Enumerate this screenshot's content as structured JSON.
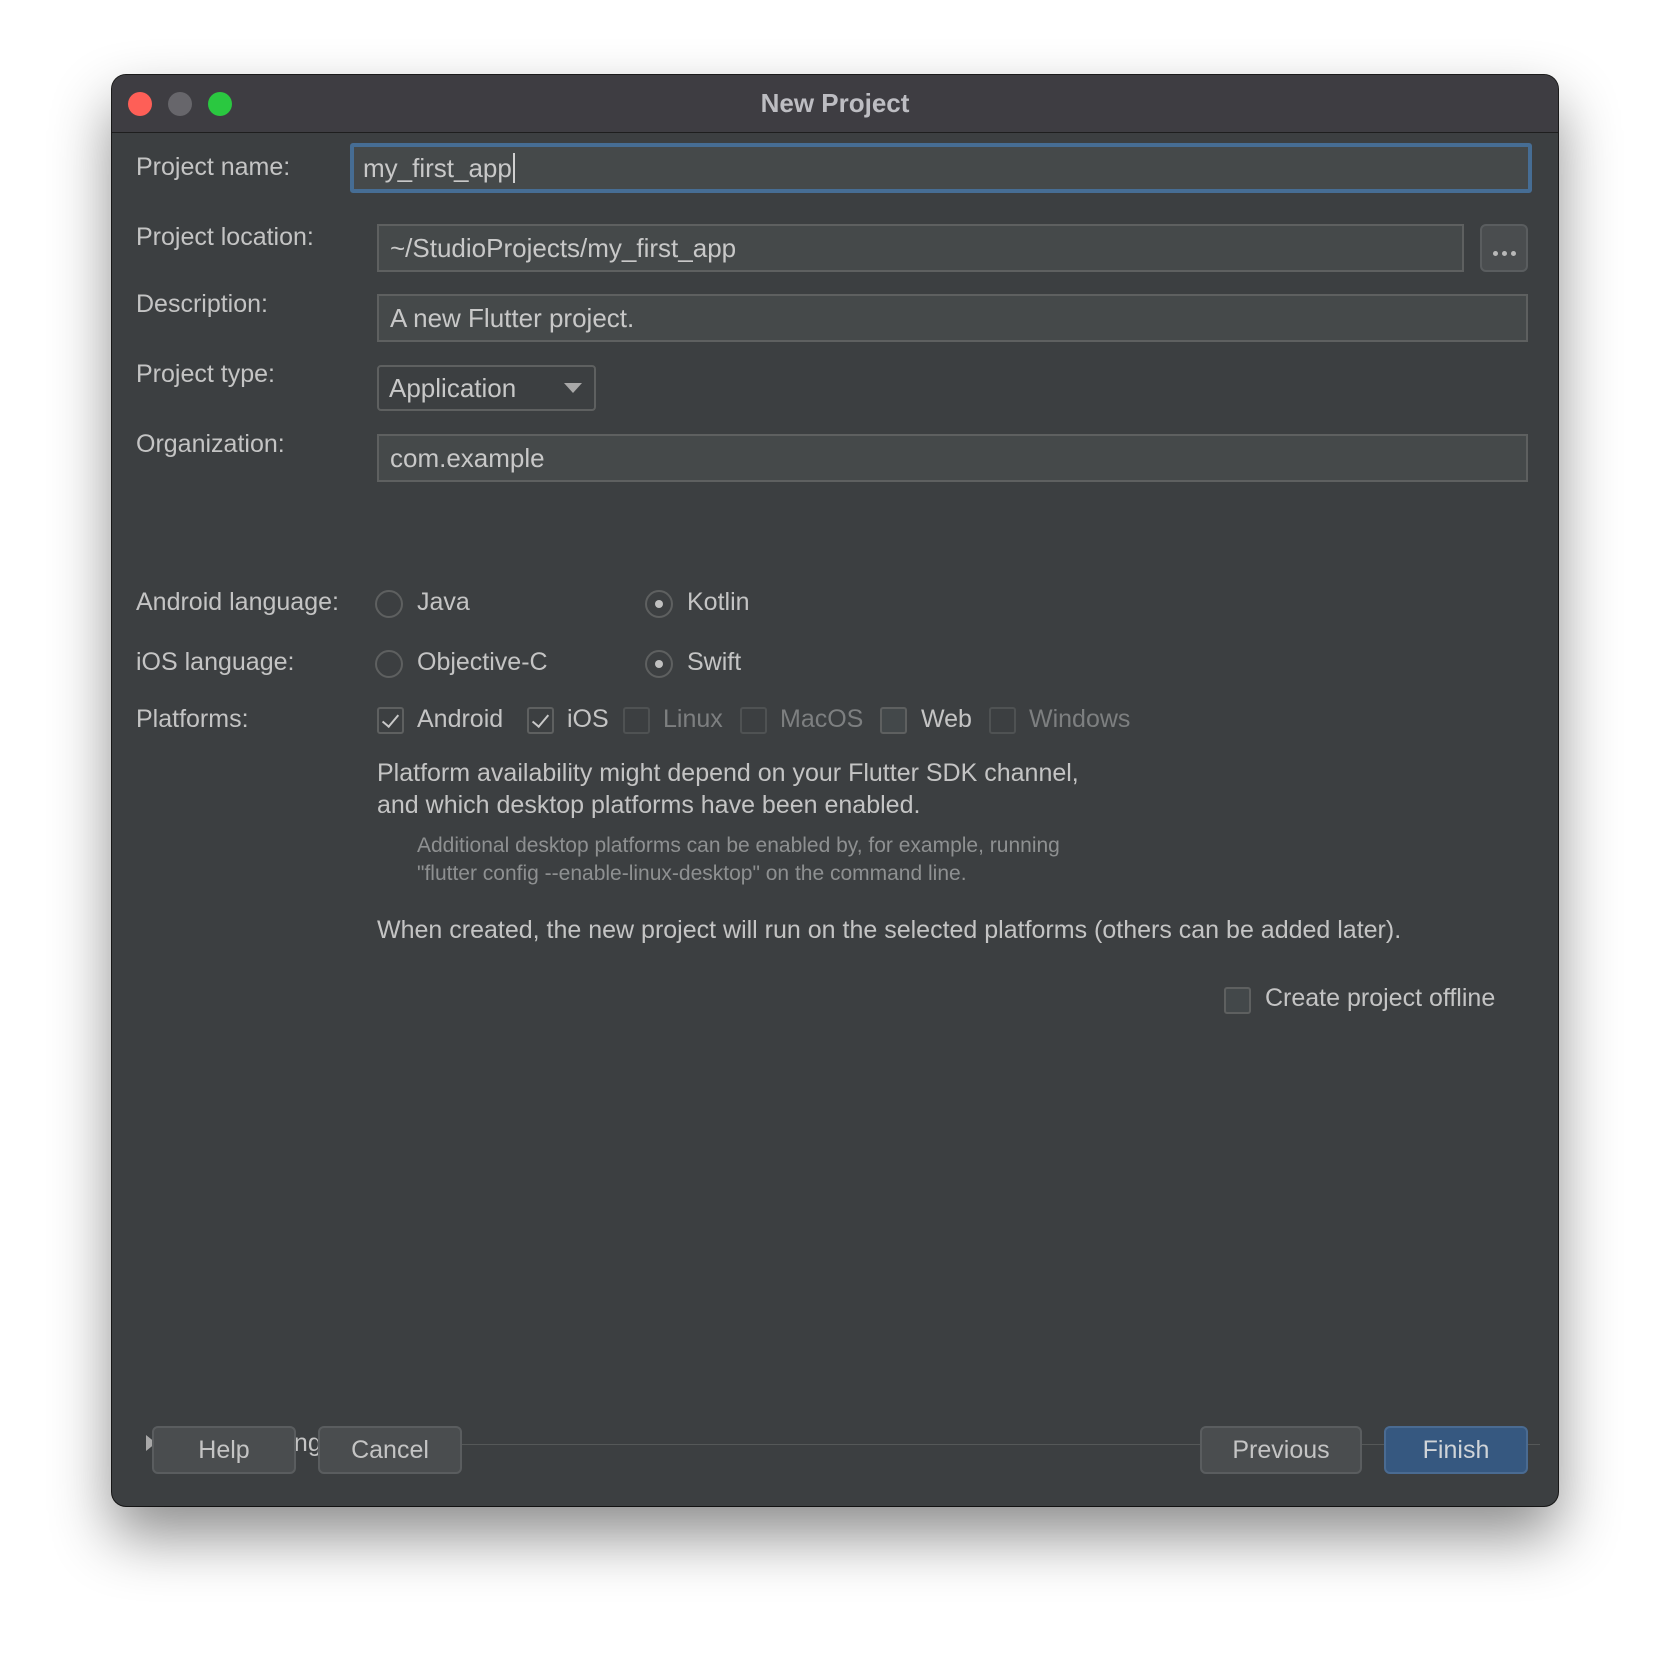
{
  "window": {
    "title": "New Project",
    "traffic_lights": [
      "close",
      "minimize",
      "maximize"
    ]
  },
  "form": {
    "project_name": {
      "label": "Project name:",
      "value": "my_first_app",
      "focused": true
    },
    "project_location": {
      "label": "Project location:",
      "value": "~/StudioProjects/my_first_app",
      "browse_label": "..."
    },
    "description": {
      "label": "Description:",
      "value": "A new Flutter project."
    },
    "project_type": {
      "label": "Project type:",
      "selected": "Application"
    },
    "organization": {
      "label": "Organization:",
      "value": "com.example"
    },
    "android_language": {
      "label": "Android language:",
      "options": [
        {
          "label": "Java",
          "selected": false
        },
        {
          "label": "Kotlin",
          "selected": true
        }
      ]
    },
    "ios_language": {
      "label": "iOS language:",
      "options": [
        {
          "label": "Objective-C",
          "selected": false
        },
        {
          "label": "Swift",
          "selected": true
        }
      ]
    },
    "platforms": {
      "label": "Platforms:",
      "items": [
        {
          "label": "Android",
          "checked": true,
          "enabled": true
        },
        {
          "label": "iOS",
          "checked": true,
          "enabled": true
        },
        {
          "label": "Linux",
          "checked": false,
          "enabled": false
        },
        {
          "label": "MacOS",
          "checked": false,
          "enabled": false
        },
        {
          "label": "Web",
          "checked": false,
          "enabled": true
        },
        {
          "label": "Windows",
          "checked": false,
          "enabled": false
        }
      ]
    },
    "info": {
      "line1": "Platform availability might depend on your Flutter SDK channel,",
      "line2": "and which desktop platforms have been enabled.",
      "hint1": "Additional desktop platforms can be enabled by, for example, running",
      "hint2": "\"flutter config --enable-linux-desktop\" on the command line.",
      "note": "When created, the new project will run on the selected platforms (others can be added later)."
    },
    "create_offline": {
      "label": "Create project offline",
      "checked": false
    }
  },
  "more_settings": {
    "label": "More Settings",
    "expanded": false
  },
  "buttons": {
    "help": "Help",
    "cancel": "Cancel",
    "previous": "Previous",
    "finish": "Finish"
  },
  "colors": {
    "background": "#3c3f41",
    "titlebar": "#3e3d42",
    "focus_border": "#466d94",
    "primary_button": "#365880"
  }
}
